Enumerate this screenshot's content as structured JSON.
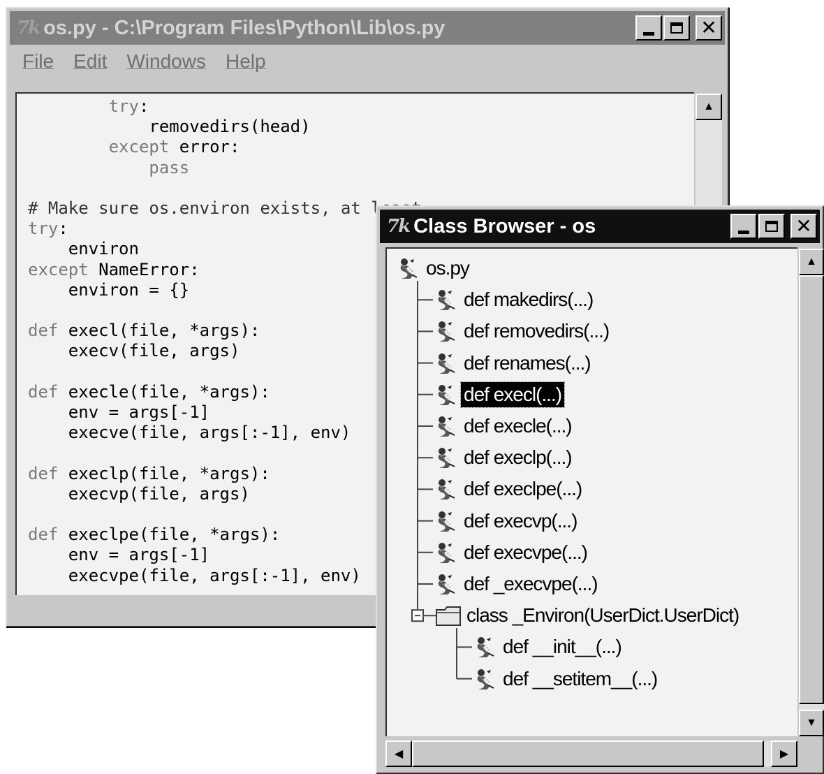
{
  "editor": {
    "title": "os.py - C:\\Program Files\\Python\\Lib\\os.py",
    "menu": [
      "File",
      "Edit",
      "Windows",
      "Help"
    ],
    "code_lines": [
      {
        "indent": "        ",
        "kw": "try",
        "rest": ":"
      },
      {
        "indent": "            ",
        "kw": "",
        "rest": "removedirs(head)"
      },
      {
        "indent": "        ",
        "kw": "except",
        "rest": " error:"
      },
      {
        "indent": "            ",
        "kw": "pass",
        "rest": ""
      },
      {
        "indent": "",
        "kw": "",
        "rest": ""
      },
      {
        "indent": "",
        "kw": "",
        "rest": "# Make sure os.environ exists, at least"
      },
      {
        "indent": "",
        "kw": "try",
        "rest": ":"
      },
      {
        "indent": "    ",
        "kw": "",
        "rest": "environ"
      },
      {
        "indent": "",
        "kw": "except",
        "rest": " NameError:"
      },
      {
        "indent": "    ",
        "kw": "",
        "rest": "environ = {}"
      },
      {
        "indent": "",
        "kw": "",
        "rest": ""
      },
      {
        "indent": "",
        "kw": "def",
        "rest": " execl(file, *args):"
      },
      {
        "indent": "    ",
        "kw": "",
        "rest": "execv(file, args)"
      },
      {
        "indent": "",
        "kw": "",
        "rest": ""
      },
      {
        "indent": "",
        "kw": "def",
        "rest": " execle(file, *args):"
      },
      {
        "indent": "    ",
        "kw": "",
        "rest": "env = args[-1]"
      },
      {
        "indent": "    ",
        "kw": "",
        "rest": "execve(file, args[:-1], env)"
      },
      {
        "indent": "",
        "kw": "",
        "rest": ""
      },
      {
        "indent": "",
        "kw": "def",
        "rest": " execlp(file, *args):"
      },
      {
        "indent": "    ",
        "kw": "",
        "rest": "execvp(file, args)"
      },
      {
        "indent": "",
        "kw": "",
        "rest": ""
      },
      {
        "indent": "",
        "kw": "def",
        "rest": " execlpe(file, *args):"
      },
      {
        "indent": "    ",
        "kw": "",
        "rest": "env = args[-1]"
      },
      {
        "indent": "    ",
        "kw": "",
        "rest": "execvpe(file, args[:-1], env)"
      }
    ]
  },
  "browser": {
    "title": "Class Browser - os",
    "root": "os.py",
    "functions": [
      "def makedirs(...)",
      "def removedirs(...)",
      "def renames(...)",
      "def execl(...)",
      "def execle(...)",
      "def execlp(...)",
      "def execlpe(...)",
      "def execvp(...)",
      "def execvpe(...)",
      "def _execvpe(...)"
    ],
    "selected_index": 3,
    "class_node": "class _Environ(UserDict.UserDict)",
    "methods": [
      "def __init__(...)",
      "def __setitem__(...)"
    ]
  },
  "icons": {
    "window_logo": "tk-feather-logo",
    "tree_leaf": "python-snake-icon",
    "tree_class": "folder-icon"
  }
}
